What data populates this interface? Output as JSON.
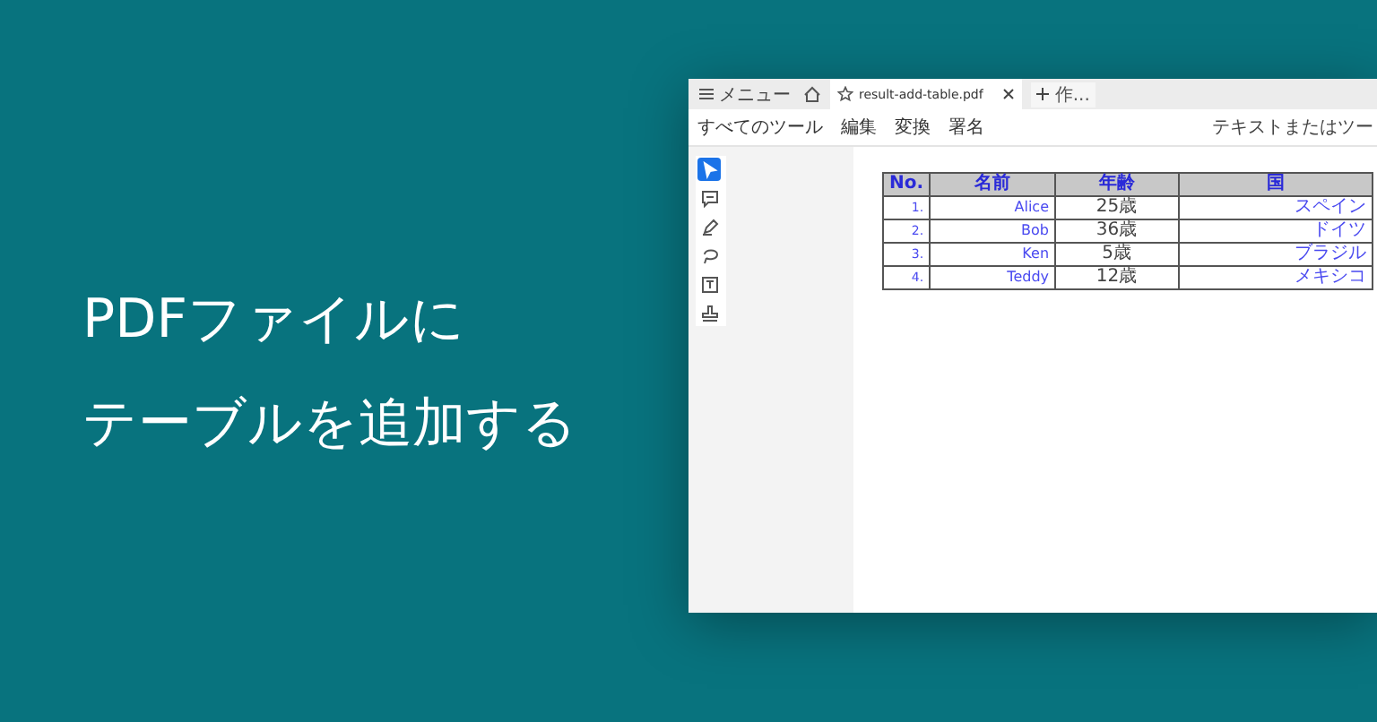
{
  "headline": [
    "PDFファイルに",
    "テーブルを追加する"
  ],
  "window": {
    "menu_button": "メニュー",
    "tab": {
      "label": "result-add-table.pdf",
      "selected": true
    },
    "new_tab": "作...",
    "menu": [
      "すべてのツール",
      "編集",
      "変換",
      "署名"
    ],
    "search": {
      "placeholder": "テキストまたはツー"
    },
    "tools": [
      {
        "kind": "select",
        "selected": true
      },
      {
        "kind": "comment",
        "selected": false
      },
      {
        "kind": "pen",
        "selected": false
      },
      {
        "kind": "lasso",
        "selected": false
      },
      {
        "kind": "textbox",
        "selected": false
      },
      {
        "kind": "stamp",
        "selected": false
      }
    ],
    "table": {
      "columns": [
        "No.",
        "名前",
        "年齢",
        "国"
      ],
      "rows": [
        [
          "1.",
          "Alice",
          "25歳",
          "スペイン"
        ],
        [
          "2.",
          "Bob",
          "36歳",
          "ドイツ"
        ],
        [
          "3.",
          "Ken",
          "5歳",
          "ブラジル"
        ],
        [
          "4.",
          "Teddy",
          "12歳",
          "メキシコ"
        ]
      ]
    }
  }
}
